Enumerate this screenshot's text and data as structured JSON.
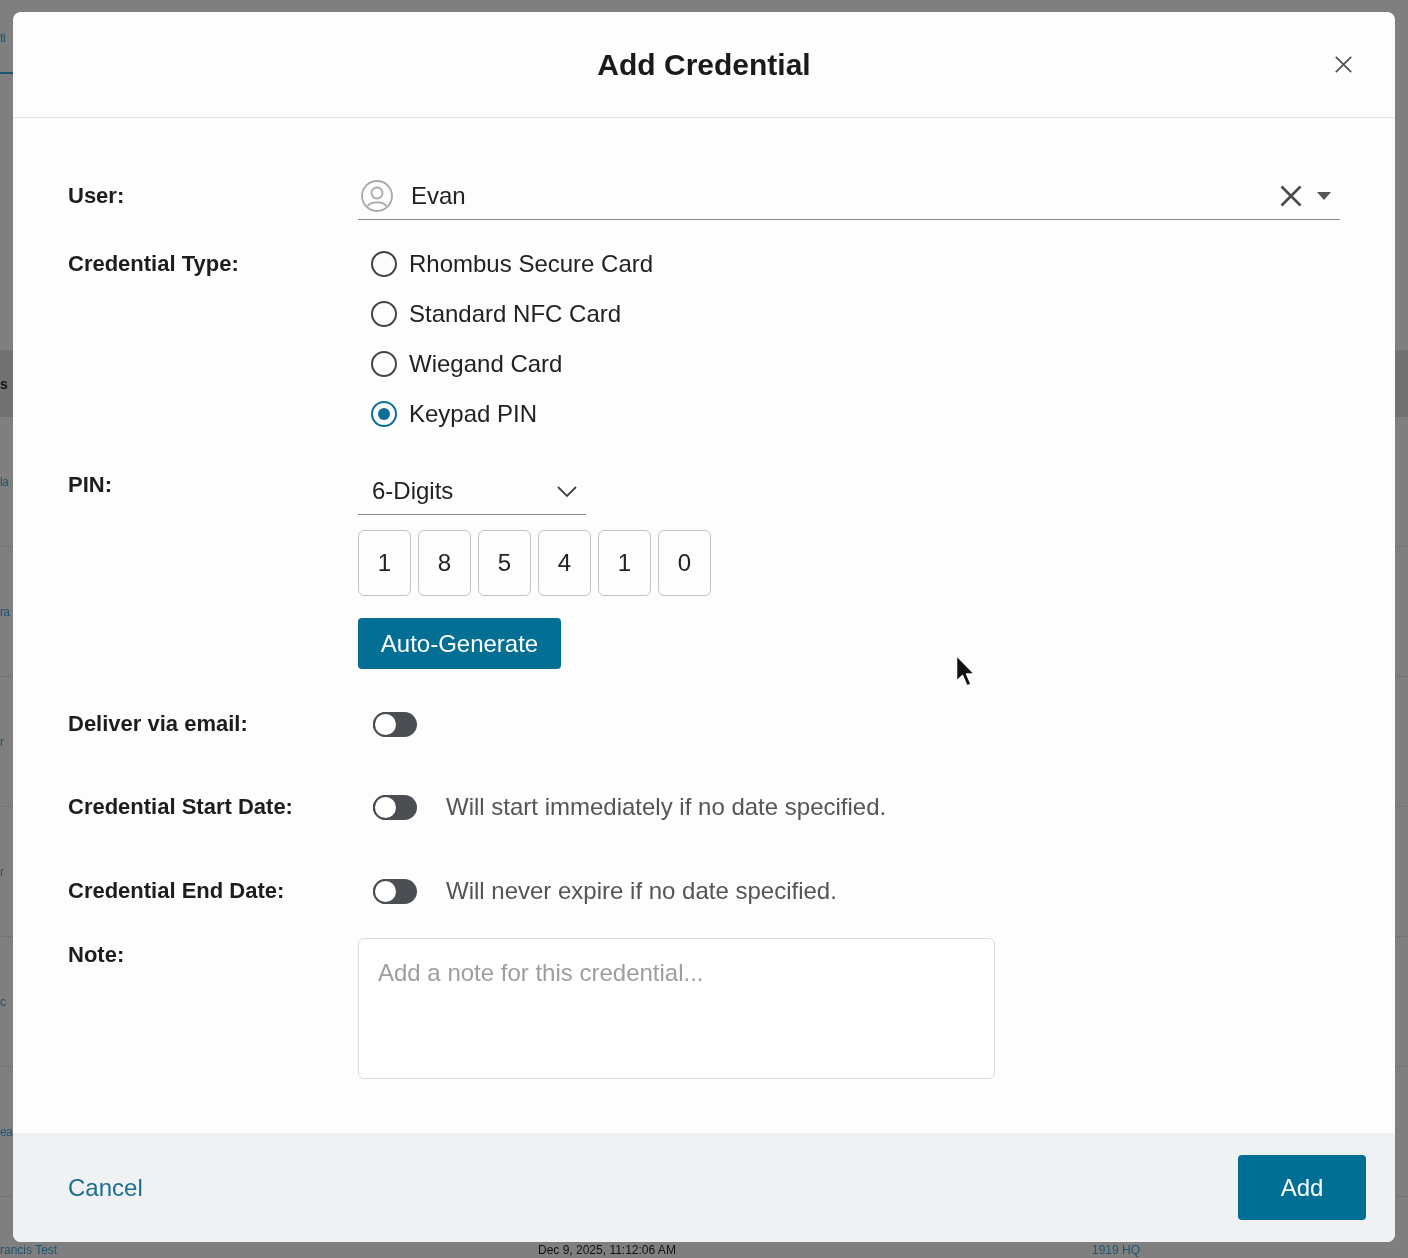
{
  "background": {
    "tab": "ti",
    "column_heading": "s",
    "row_fragments": [
      "la",
      "ra",
      "r",
      "r",
      "c",
      "ea"
    ],
    "bottom_row": {
      "name": "rancis Test",
      "date": "Dec 9, 2025, 11:12:06 AM",
      "location": "1919 HQ"
    }
  },
  "dialog": {
    "title": "Add Credential"
  },
  "form": {
    "user": {
      "label": "User:",
      "value": "Evan"
    },
    "credential_type": {
      "label": "Credential Type:",
      "options": [
        {
          "label": "Rhombus Secure Card",
          "selected": false
        },
        {
          "label": "Standard NFC Card",
          "selected": false
        },
        {
          "label": "Wiegand Card",
          "selected": false
        },
        {
          "label": "Keypad PIN",
          "selected": true
        }
      ]
    },
    "pin": {
      "label": "PIN:",
      "length": "6-Digits",
      "digits": [
        "1",
        "8",
        "5",
        "4",
        "1",
        "0"
      ],
      "auto_generate": "Auto-Generate"
    },
    "toggles": [
      {
        "label": "Deliver via email:",
        "on": false
      },
      {
        "label": "Credential Start Date:",
        "on": false,
        "hint": "Will start immediately if no date specified."
      },
      {
        "label": "Credential End Date:",
        "on": false,
        "hint": "Will never expire if no date specified."
      }
    ],
    "note": {
      "label": "Note:",
      "placeholder": "Add a note for this credential..."
    }
  },
  "footer": {
    "cancel": "Cancel",
    "add": "Add"
  }
}
